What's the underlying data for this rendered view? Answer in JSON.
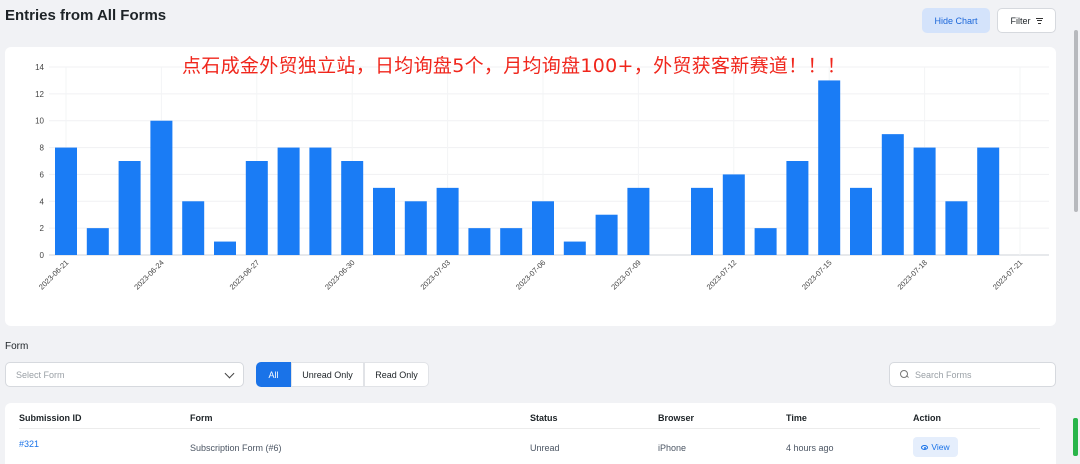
{
  "header": {
    "title": "Entries from All Forms",
    "hide_chart_label": "Hide Chart",
    "filter_label": "Filter"
  },
  "banner": "点石成金外贸独立站，日均询盘5个，月均询盘100+，外贸获客新赛道！！！",
  "colors": {
    "bar": "#1a7cf5",
    "accent": "#1a73e8",
    "banner": "#f0261c"
  },
  "chart_data": {
    "type": "bar",
    "categories": [
      "2023-06-21",
      "2023-06-22",
      "2023-06-23",
      "2023-06-24",
      "2023-06-25",
      "2023-06-26",
      "2023-06-27",
      "2023-06-28",
      "2023-06-29",
      "2023-06-30",
      "2023-07-01",
      "2023-07-02",
      "2023-07-03",
      "2023-07-04",
      "2023-07-05",
      "2023-07-06",
      "2023-07-07",
      "2023-07-08",
      "2023-07-09",
      "2023-07-10",
      "2023-07-11",
      "2023-07-12",
      "2023-07-13",
      "2023-07-14",
      "2023-07-15",
      "2023-07-16",
      "2023-07-17",
      "2023-07-18",
      "2023-07-19",
      "2023-07-20",
      "2023-07-21"
    ],
    "values": [
      8,
      2,
      7,
      10,
      4,
      1,
      7,
      8,
      8,
      7,
      5,
      4,
      5,
      2,
      2,
      4,
      1,
      3,
      5,
      0,
      5,
      6,
      2,
      7,
      13,
      5,
      9,
      8,
      4,
      8,
      0
    ],
    "x_tick_labels": [
      "2023-06-21",
      "2023-06-24",
      "2023-06-27",
      "2023-06-30",
      "2023-07-03",
      "2023-07-06",
      "2023-07-09",
      "2023-07-12",
      "2023-07-15",
      "2023-07-18",
      "2023-07-21"
    ],
    "y_ticks": [
      0,
      2,
      4,
      6,
      8,
      10,
      12,
      14
    ],
    "ylim": [
      0,
      14
    ],
    "grid": true,
    "title": "",
    "xlabel": "",
    "ylabel": ""
  },
  "filters": {
    "form_label": "Form",
    "select_placeholder": "Select Form",
    "segments": [
      "All",
      "Unread Only",
      "Read Only"
    ],
    "active_segment": "All",
    "search_placeholder": "Search Forms"
  },
  "table": {
    "headers": [
      "Submission ID",
      "Form",
      "Status",
      "Browser",
      "Time",
      "Action"
    ],
    "rows": [
      {
        "id": "#321",
        "form": "Subscription Form (#6)",
        "status": "Unread",
        "browser": "iPhone",
        "time": "4 hours ago",
        "action": "View"
      }
    ]
  }
}
